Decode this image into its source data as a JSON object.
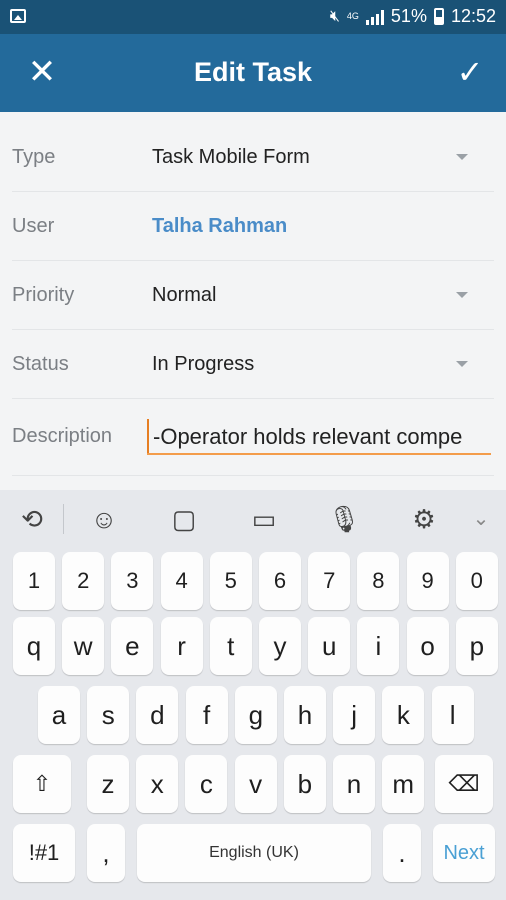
{
  "status_bar": {
    "battery": "51%",
    "time": "12:52",
    "network": "4G"
  },
  "app_bar": {
    "title": "Edit Task"
  },
  "form": {
    "type": {
      "label": "Type",
      "value": "Task Mobile Form"
    },
    "user": {
      "label": "User",
      "value": "Talha Rahman"
    },
    "priority": {
      "label": "Priority",
      "value": "Normal"
    },
    "status": {
      "label": "Status",
      "value": "In Progress"
    },
    "description": {
      "label": "Description",
      "value": "-Operator holds relevant compe"
    }
  },
  "keyboard": {
    "row_numbers": [
      "1",
      "2",
      "3",
      "4",
      "5",
      "6",
      "7",
      "8",
      "9",
      "0"
    ],
    "row_q": [
      "q",
      "w",
      "e",
      "r",
      "t",
      "y",
      "u",
      "i",
      "o",
      "p"
    ],
    "row_a": [
      "a",
      "s",
      "d",
      "f",
      "g",
      "h",
      "j",
      "k",
      "l"
    ],
    "row_z": [
      "z",
      "x",
      "c",
      "v",
      "b",
      "n",
      "m"
    ],
    "symbols_label": "!#1",
    "comma_label": ",",
    "space_label": "English (UK)",
    "period_label": ".",
    "action_label": "Next"
  }
}
